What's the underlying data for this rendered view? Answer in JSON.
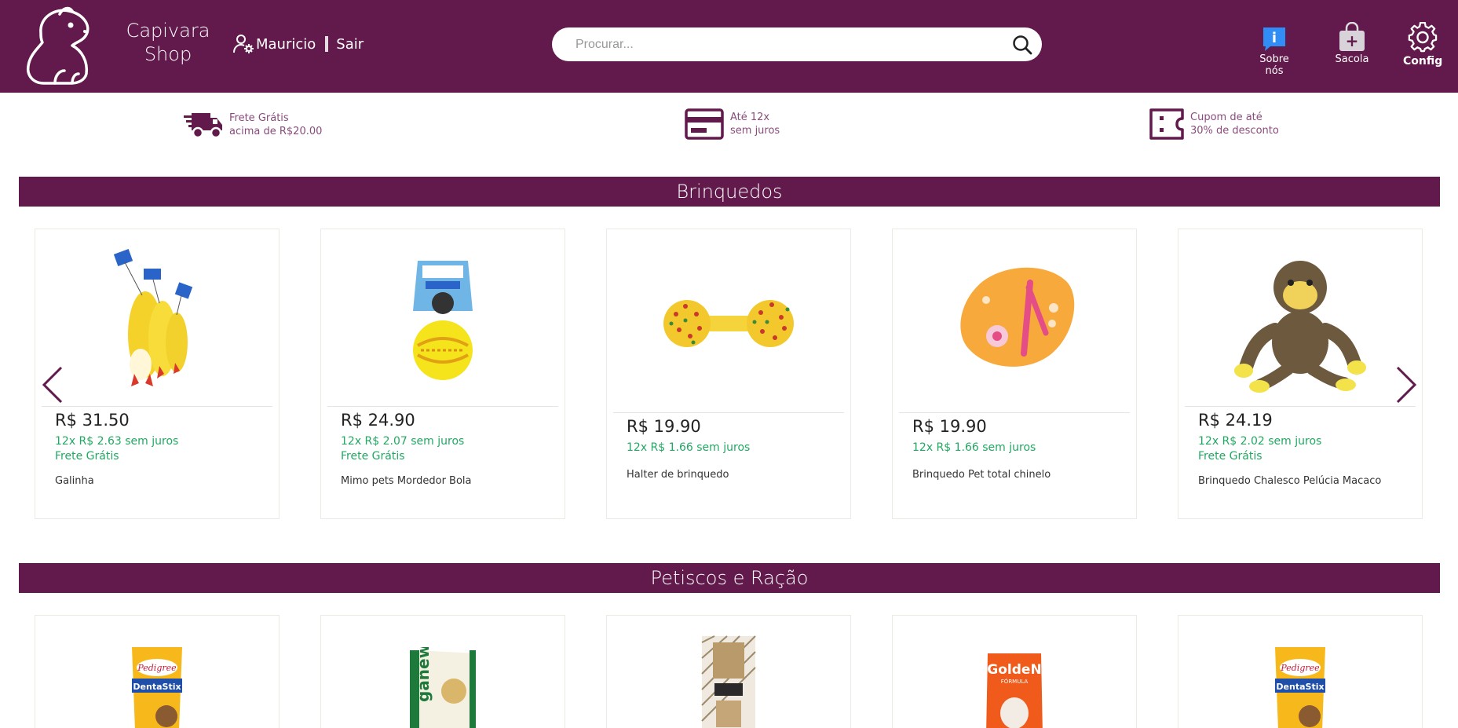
{
  "header": {
    "brand_line1": "Capivara",
    "brand_line2": "Shop",
    "user_name": "Mauricio",
    "logout_label": "Sair",
    "search_placeholder": "Procurar...",
    "about_label": "Sobre nós",
    "about_icon_glyph": "i",
    "bag_label": "Sacola",
    "bag_icon_glyph": "+",
    "config_label": "Config"
  },
  "benefits": [
    {
      "icon": "truck-icon",
      "line1": "Frete Grátis",
      "line2": "acima de R$20.00"
    },
    {
      "icon": "credit-card-icon",
      "line1": "Até 12x",
      "line2": "sem juros"
    },
    {
      "icon": "coupon-icon",
      "line1": "Cupom de até",
      "line2": "30% de desconto"
    }
  ],
  "sections": {
    "toys": {
      "title": "Brinquedos",
      "products": [
        {
          "price": "R$ 31.50",
          "installments": "12x R$ 2.63 sem juros",
          "shipping": "Frete Grátis",
          "name": "Galinha",
          "image": "rubber-chicken-toy"
        },
        {
          "price": "R$ 24.90",
          "installments": "12x R$ 2.07 sem juros",
          "shipping": "Frete Grátis",
          "name": "Mimo pets Mordedor Bola",
          "image": "biter-ball-toy"
        },
        {
          "price": "R$ 19.90",
          "installments": "12x R$ 1.66 sem juros",
          "shipping": "",
          "name": "Halter de brinquedo",
          "image": "dumbbell-toy"
        },
        {
          "price": "R$ 19.90",
          "installments": "12x R$ 1.66 sem juros",
          "shipping": "",
          "name": "Brinquedo Pet total chinelo",
          "image": "flip-flop-toy"
        },
        {
          "price": "R$ 24.19",
          "installments": "12x R$ 2.02 sem juros",
          "shipping": "Frete Grátis",
          "name": "Brinquedo Chalesco Pelúcia Macaco",
          "image": "plush-monkey-toy"
        }
      ]
    },
    "treats": {
      "title": "Petiscos e Ração",
      "products": [
        {
          "image": "pedigree-dentastix-pack",
          "pack_brand": "Pedigree",
          "pack_name": "DentaStix"
        },
        {
          "image": "organew-treat-pack",
          "pack_brand": "ganew"
        },
        {
          "image": "chew-sticks-pack"
        },
        {
          "image": "golden-formula-food-bag",
          "pack_brand": "GoldeN",
          "pack_name": "FÓRMULA"
        },
        {
          "image": "pedigree-dentastix-pack",
          "pack_brand": "Pedigree",
          "pack_name": "DentaStix"
        }
      ]
    }
  },
  "colors": {
    "brand": "#611a4b",
    "installments": "#22a862",
    "benefit_text": "#8a4b7c"
  }
}
